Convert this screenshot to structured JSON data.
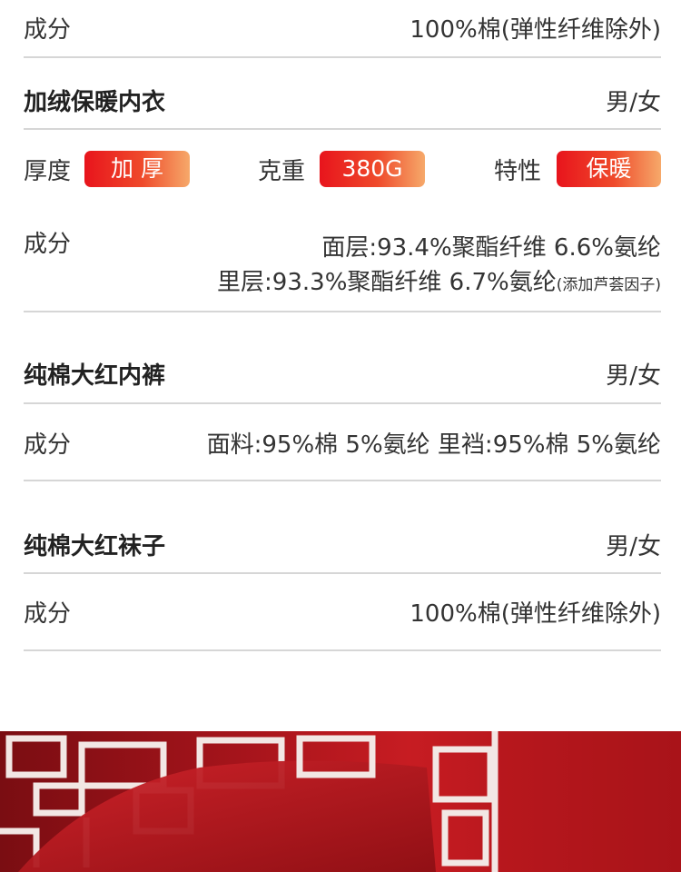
{
  "top": {
    "label": "成分",
    "value": "100%棉(弹性纤维除外)"
  },
  "section1": {
    "title": "加绒保暖内衣",
    "gender": "男/女",
    "thickness_label": "厚度",
    "thickness_value": "加 厚",
    "weight_label": "克重",
    "weight_value": "380G",
    "feature_label": "特性",
    "feature_value": "保暖",
    "composition_label": "成分",
    "composition_line1": "面层:93.4%聚酯纤维  6.6%氨纶",
    "composition_line2": "里层:93.3%聚酯纤维  6.7%氨纶",
    "composition_note": "(添加芦荟因子)"
  },
  "section2": {
    "title": "纯棉大红内裤",
    "gender": "男/女",
    "composition_label": "成分",
    "composition_value": "面料:95%棉 5%氨纶  里裆:95%棉 5%氨纶"
  },
  "section3": {
    "title": "纯棉大红袜子",
    "gender": "男/女",
    "composition_label": "成分",
    "composition_value": "100%棉(弹性纤维除外)"
  },
  "colors": {
    "accent_start": "#e8141c",
    "accent_end": "#f6a96a",
    "banner_red": "#c71c22"
  }
}
